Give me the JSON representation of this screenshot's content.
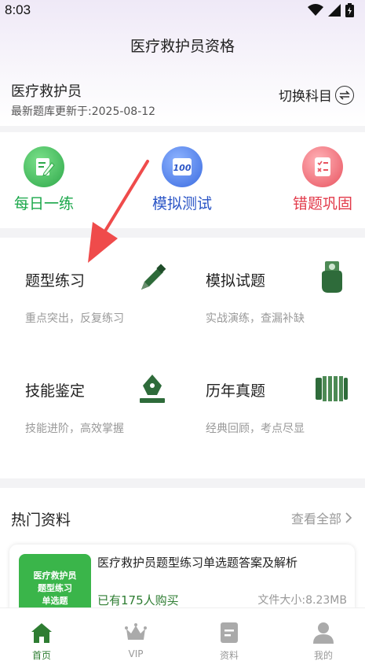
{
  "status_bar": {
    "time": "8:03"
  },
  "header": {
    "title": "医疗救护员资格"
  },
  "subject": {
    "name": "医疗救护员",
    "update_text": "最新题库更新于:2025-08-12",
    "switch_label": "切换科目"
  },
  "quick_actions": [
    {
      "label": "每日一练",
      "icon": "edit-note-icon",
      "color": "#1aa74a"
    },
    {
      "label": "模拟测试",
      "icon": "score-100-icon",
      "color": "#2b55c6"
    },
    {
      "label": "错题巩固",
      "icon": "checklist-icon",
      "color": "#e23a4a"
    }
  ],
  "practice_grid": [
    {
      "title": "题型练习",
      "subtitle": "重点突出，反复练习",
      "icon": "pencil-icon"
    },
    {
      "title": "模拟试题",
      "subtitle": "实战演练，查漏补缺",
      "icon": "hand-card-icon"
    },
    {
      "title": "技能鉴定",
      "subtitle": "技能进阶，高效掌握",
      "icon": "pen-nib-icon"
    },
    {
      "title": "历年真题",
      "subtitle": "经典回顾，考点尽显",
      "icon": "scroll-icon"
    }
  ],
  "hot_resources": {
    "title": "热门资料",
    "more_label": "查看全部",
    "items": [
      {
        "thumb_lines": [
          "医疗救护员",
          "题型练习",
          "单选题"
        ],
        "title": "医疗救护员题型练习单选题答案及解析",
        "buyers": "已有175人购买",
        "size": "文件大小:8.23MB"
      }
    ]
  },
  "bottom_nav": [
    {
      "label": "首页",
      "icon": "home-icon",
      "active": true
    },
    {
      "label": "VIP",
      "icon": "crown-icon",
      "active": false
    },
    {
      "label": "资料",
      "icon": "document-icon",
      "active": false
    },
    {
      "label": "我的",
      "icon": "user-icon",
      "active": false
    }
  ],
  "colors": {
    "accent_green": "#2e7d32",
    "annotation_arrow": "#ef4b4b"
  }
}
